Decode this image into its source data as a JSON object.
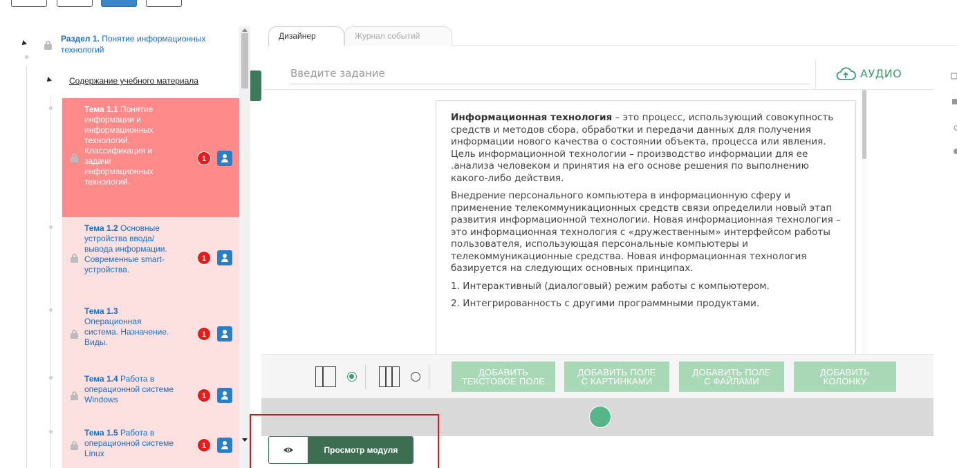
{
  "tree": {
    "section": {
      "number": "Раздел 1.",
      "title": "Понятие информационных технологий"
    },
    "content_link": "Содержание учебного материала",
    "topics": [
      {
        "number": "Тема 1.1",
        "title": "Понятие информации и информационных технологий. Классификация и задачи информационных технологий.",
        "badge": "1",
        "active": true
      },
      {
        "number": "Тема 1.2",
        "title": "Основные устройства ввода/вывода информации. Современные smart-устройства.",
        "badge": "1",
        "active": false
      },
      {
        "number": "Тема 1.3",
        "title": "Операционная система. Назначение. Виды.",
        "badge": "1",
        "active": false
      },
      {
        "number": "Тема 1.4",
        "title": "Работа в операционной системе Windows",
        "badge": "1",
        "active": false
      },
      {
        "number": "Тема 1.5",
        "title": "Работа в операционной системе Linux",
        "badge": "1",
        "active": false
      }
    ]
  },
  "tabs": {
    "designer": "Дизайнер",
    "log": "Журнал событий"
  },
  "task": {
    "placeholder": "Введите задание",
    "audio_label": "АУДИО"
  },
  "content": {
    "p1_bold": "Информационная технология",
    "p1_rest": " – это процесс, использующий совокупность средств и методов сбора, обработки и передачи данных для получения информации нового качества о состоянии объекта, процесса или явления. Цель информационной технологии – производство информации для ее .анализа человеком и принятия на его основе решения по выполнению какого-либо действия.",
    "p2": "Внедрение персонального компьютера в информационную сферу и применение телекоммуникационных средств связи определили новый этап развития информационной технологии. Новая информационная технология – это информационная технология с «дружественным» интерфейсом работы пользователя, использующая персональные компьютеры и телекоммуникационные средства. Новая информационная технология базируется на следующих основных принципах.",
    "p3": "1. Интерактивный (диалоговый) режим работы с компьютером.",
    "p4": "2. Интегрированность с другими программными продуктами."
  },
  "toolbar": {
    "add_text_l1": "ДОБАВИТЬ",
    "add_text_l2": "ТЕКСТОВОЕ ПОЛЕ",
    "add_images_l1": "ДОБАВИТЬ ПОЛЕ",
    "add_images_l2": "С КАРТИНКАМИ",
    "add_files_l1": "ДОБАВИТЬ ПОЛЕ",
    "add_files_l2": "С ФАЙЛАМИ",
    "add_column_l1": "ДОБАВИТЬ",
    "add_column_l2": "КОЛОНКУ",
    "selected_layout": "one-column"
  },
  "footer": {
    "preview_label": "Просмотр модуля"
  },
  "colors": {
    "accent_green": "#3d6e52",
    "light_green": "#a8d8b6",
    "active_topic": "#ff8a8a",
    "topic_bg": "#fde1e1",
    "link_blue": "#1a6dbf",
    "badge_red": "#e81a1a",
    "highlight_red": "#e01414"
  },
  "icons": {
    "lock": "lock-icon",
    "user": "user-icon",
    "cloud_upload": "cloud-upload-icon",
    "eye": "eye-icon"
  }
}
